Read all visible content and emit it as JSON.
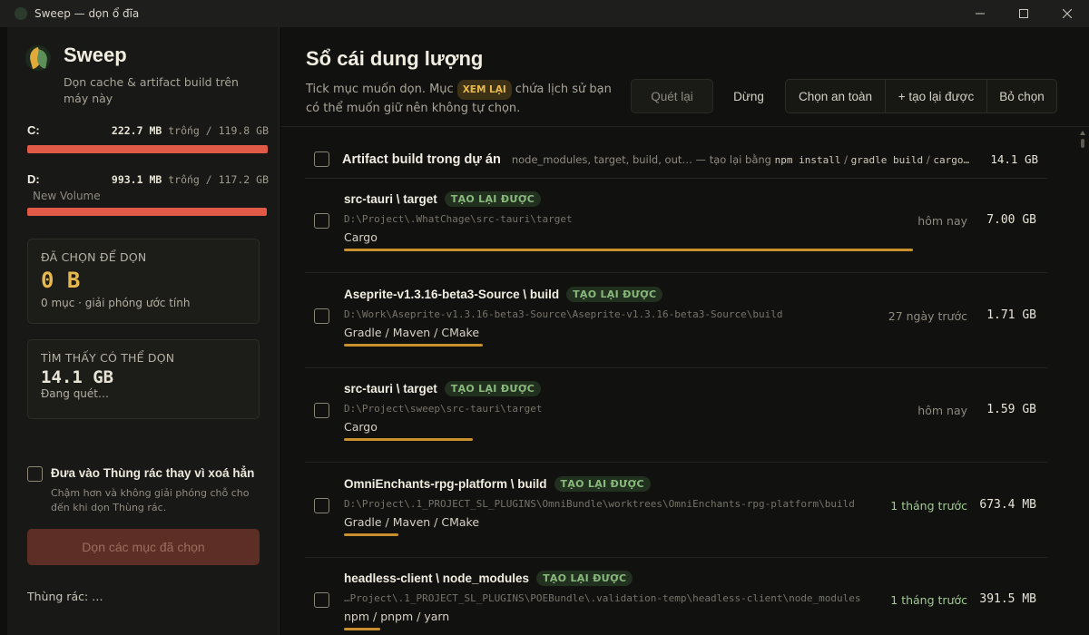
{
  "window": {
    "title": "Sweep — dọn ổ đĩa"
  },
  "sidebar": {
    "app_name": "Sweep",
    "tagline": "Dọn cache & artifact build trên máy này",
    "drives": [
      {
        "letter": "C:",
        "free": "222.7 MB",
        "rest": " trống / 119.8 GB",
        "volume": "",
        "used_fraction": 0.998
      },
      {
        "letter": "D:",
        "free": "993.1 MB",
        "rest": " trống / 117.2 GB",
        "volume": "New Volume",
        "used_fraction": 0.992
      }
    ],
    "selected": {
      "label": "ĐÃ CHỌN ĐỂ DỌN",
      "value": "0 B",
      "sub": "0 mục · giải phóng ước tính"
    },
    "found": {
      "label": "TÌM THẤY CÓ THỂ DỌN",
      "value": "14.1 GB",
      "sub": "Đang quét…"
    },
    "trash_option": {
      "title": "Đưa vào Thùng rác thay vì xoá hẳn",
      "desc": "Chậm hơn và không giải phóng chỗ cho đến khi dọn Thùng rác.",
      "checked": false
    },
    "clean_button": "Dọn các mục đã chọn",
    "trash_status": "Thùng rác:  …"
  },
  "main": {
    "title": "Sổ cái dung lượng",
    "desc_before": "Tick mục muốn dọn. Mục",
    "desc_chip": "XEM LẠI",
    "desc_after": "chứa lịch sử bạn có thể muốn giữ nên không tự chọn.",
    "rescan_button": "Quét lại",
    "stop_button": "Dừng",
    "select_safe_button": "Chọn an toàn",
    "select_rebuildable_button": "+ tạo lại được",
    "deselect_button": "Bỏ chọn"
  },
  "group": {
    "title": "Artifact build trong dự án",
    "desc_prefix": "node_modules, target, build, out… — tạo lại bằng",
    "desc_cmd1": "npm install",
    "desc_sep1": "/",
    "desc_cmd2": "gradle build",
    "desc_sep2": "/",
    "desc_cmd3": "cargo…",
    "size": "14.1 GB"
  },
  "items": [
    {
      "name": "src-tauri \\ target",
      "tag": "TẠO LẠI ĐƯỢC",
      "path": "D:\\Project\\.WhatChage\\src-tauri\\target",
      "type": "Cargo",
      "time": "hôm nay",
      "time_recent": false,
      "size": "7.00 GB",
      "size_fraction": 1.0
    },
    {
      "name": "Aseprite-v1.3.16-beta3-Source \\ build",
      "tag": "TẠO LẠI ĐƯỢC",
      "path": "D:\\Work\\Aseprite-v1.3.16-beta3-Source\\Aseprite-v1.3.16-beta3-Source\\build",
      "type": "Gradle / Maven / CMake",
      "time": "27 ngày trước",
      "time_recent": false,
      "size": "1.71 GB",
      "size_fraction": 0.244
    },
    {
      "name": "src-tauri \\ target",
      "tag": "TẠO LẠI ĐƯỢC",
      "path": "D:\\Project\\sweep\\src-tauri\\target",
      "type": "Cargo",
      "time": "hôm nay",
      "time_recent": false,
      "size": "1.59 GB",
      "size_fraction": 0.227
    },
    {
      "name": "OmniEnchants-rpg-platform \\ build",
      "tag": "TẠO LẠI ĐƯỢC",
      "path": "D:\\Project\\.1_PROJECT_SL_PLUGINS\\OmniBundle\\worktrees\\OmniEnchants-rpg-platform\\build",
      "type": "Gradle / Maven / CMake",
      "time": "1 tháng trước",
      "time_recent": true,
      "size": "673.4 MB",
      "size_fraction": 0.096
    },
    {
      "name": "headless-client \\ node_modules",
      "tag": "TẠO LẠI ĐƯỢC",
      "path": "…Project\\.1_PROJECT_SL_PLUGINS\\POEBundle\\.validation-temp\\headless-client\\node_modules",
      "type": "npm / pnpm / yarn",
      "time": "1 tháng trước",
      "time_recent": true,
      "size": "391.5 MB",
      "size_fraction": 0.055
    }
  ],
  "colors": {
    "accent": "#c8912e",
    "danger": "#e05a47",
    "tag_green": "#89b97c"
  }
}
